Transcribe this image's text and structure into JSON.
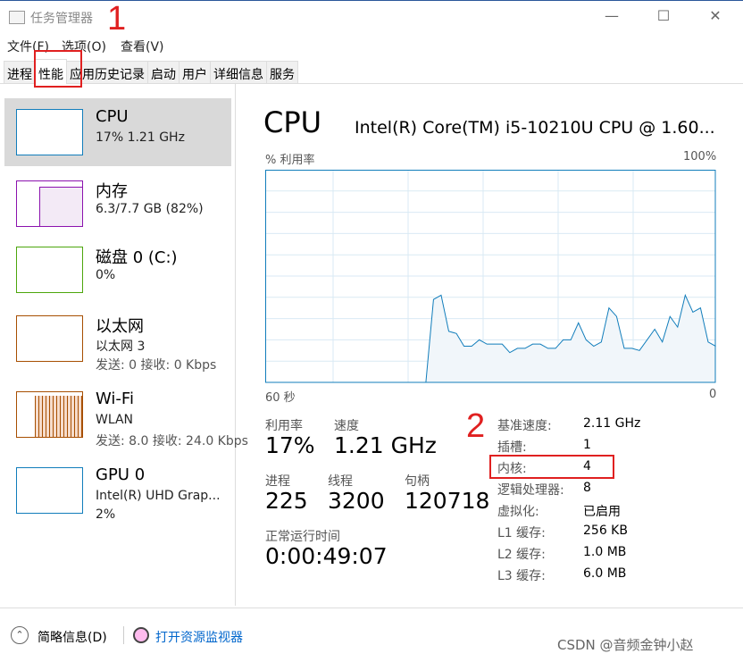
{
  "window": {
    "title": "任务管理器",
    "minimize": "—",
    "maximize": "☐",
    "close": "✕"
  },
  "annotations": {
    "one": "1",
    "two": "2"
  },
  "menu": [
    "文件(F)",
    "选项(O)",
    "查看(V)"
  ],
  "tabs": [
    "进程",
    "性能",
    "应用历史记录",
    "启动",
    "用户",
    "详细信息",
    "服务"
  ],
  "sidebar": [
    {
      "name": "CPU",
      "sub1": "17% 1.21 GHz",
      "color": "#117dbb"
    },
    {
      "name": "内存",
      "sub1": "6.3/7.7 GB (82%)",
      "color": "#8b12ae"
    },
    {
      "name": "磁盘 0 (C:)",
      "sub1": "0%",
      "color": "#4da60c"
    },
    {
      "name": "以太网",
      "sub1": "以太网 3",
      "sub2": "发送: 0 接收: 0 Kbps",
      "color": "#a74f01"
    },
    {
      "name": "Wi-Fi",
      "sub1": "WLAN",
      "sub2": "发送: 8.0 接收: 24.0 Kbps",
      "color": "#a74f01"
    },
    {
      "name": "GPU 0",
      "sub1": "Intel(R) UHD Grap...",
      "sub2": "2%",
      "color": "#117dbb"
    }
  ],
  "main": {
    "title": "CPU",
    "model": "Intel(R) Core(TM) i5-10210U CPU @ 1.60...",
    "graph_label": "% 利用率",
    "graph_max": "100%",
    "graph_left": "60 秒",
    "graph_right": "0",
    "util_label": "利用率",
    "util": "17%",
    "speed_label": "速度",
    "speed": "1.21 GHz",
    "proc_label": "进程",
    "proc": "225",
    "thread_label": "线程",
    "thread": "3200",
    "handle_label": "句柄",
    "handle": "120718",
    "uptime_label": "正常运行时间",
    "uptime": "0:00:49:07",
    "specs": [
      [
        "基准速度:",
        "2.11 GHz"
      ],
      [
        "插槽:",
        "1"
      ],
      [
        "内核:",
        "4"
      ],
      [
        "逻辑处理器:",
        "8"
      ],
      [
        "虚拟化:",
        "已启用"
      ],
      [
        "L1 缓存:",
        "256 KB"
      ],
      [
        "L2 缓存:",
        "1.0 MB"
      ],
      [
        "L3 缓存:",
        "6.0 MB"
      ]
    ]
  },
  "chart_data": {
    "type": "area",
    "ylim": [
      0,
      100
    ],
    "xlabel_left": "60 秒",
    "xlabel_right": "0",
    "ylabel": "% 利用率",
    "ymax_label": "100%",
    "grid": true,
    "color": "#117dbb",
    "values": [
      0,
      0,
      0,
      0,
      0,
      0,
      0,
      0,
      0,
      0,
      0,
      0,
      0,
      0,
      0,
      0,
      0,
      0,
      0,
      0,
      0,
      0,
      39,
      41,
      24,
      23,
      17,
      17,
      20,
      18,
      18,
      18,
      14,
      16,
      16,
      18,
      18,
      16,
      16,
      20,
      20,
      28,
      20,
      17,
      19,
      35,
      31,
      16,
      16,
      15,
      20,
      25,
      19,
      31,
      26,
      41,
      33,
      35,
      19,
      17
    ]
  },
  "footer": {
    "brief": "简略信息(D)",
    "monitor": "打开资源监视器",
    "watermark": "CSDN @音频金钟小赵"
  }
}
